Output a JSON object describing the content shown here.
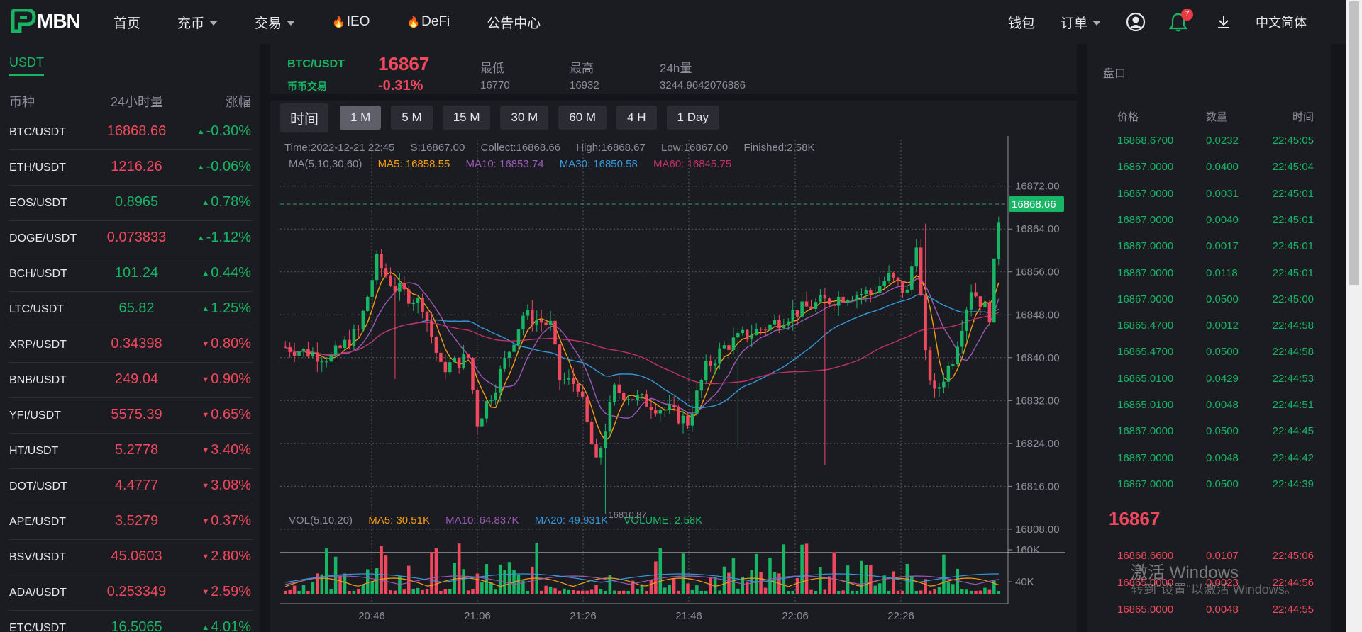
{
  "header": {
    "logo_text": "MBN",
    "nav": [
      {
        "label": "首页",
        "caret": false,
        "fire": false
      },
      {
        "label": "充币",
        "caret": true,
        "fire": false
      },
      {
        "label": "交易",
        "caret": true,
        "fire": false
      },
      {
        "label": "IEO",
        "caret": false,
        "fire": true
      },
      {
        "label": "DeFi",
        "caret": false,
        "fire": true
      },
      {
        "label": "公告中心",
        "caret": false,
        "fire": false
      }
    ],
    "wallet": "钱包",
    "orders": "订单",
    "notification_count": "7",
    "language": "中文简体"
  },
  "market": {
    "tab": "USDT",
    "col_coin": "币种",
    "col_volume": "24小时量",
    "col_change": "涨幅",
    "rows": [
      {
        "symbol": "BTC/USDT",
        "price": "16868.66",
        "change": "-0.30%",
        "price_dir": "down",
        "change_dir": "up"
      },
      {
        "symbol": "ETH/USDT",
        "price": "1216.26",
        "change": "-0.06%",
        "price_dir": "down",
        "change_dir": "up"
      },
      {
        "symbol": "EOS/USDT",
        "price": "0.8965",
        "change": "0.78%",
        "price_dir": "up",
        "change_dir": "up"
      },
      {
        "symbol": "DOGE/USDT",
        "price": "0.073833",
        "change": "-1.12%",
        "price_dir": "down",
        "change_dir": "up"
      },
      {
        "symbol": "BCH/USDT",
        "price": "101.24",
        "change": "0.44%",
        "price_dir": "up",
        "change_dir": "up"
      },
      {
        "symbol": "LTC/USDT",
        "price": "65.82",
        "change": "1.25%",
        "price_dir": "up",
        "change_dir": "up"
      },
      {
        "symbol": "XRP/USDT",
        "price": "0.34398",
        "change": "0.80%",
        "price_dir": "down",
        "change_dir": "down"
      },
      {
        "symbol": "BNB/USDT",
        "price": "249.04",
        "change": "0.90%",
        "price_dir": "down",
        "change_dir": "down"
      },
      {
        "symbol": "YFI/USDT",
        "price": "5575.39",
        "change": "0.65%",
        "price_dir": "down",
        "change_dir": "down"
      },
      {
        "symbol": "HT/USDT",
        "price": "5.2778",
        "change": "3.40%",
        "price_dir": "down",
        "change_dir": "down"
      },
      {
        "symbol": "DOT/USDT",
        "price": "4.4777",
        "change": "3.08%",
        "price_dir": "down",
        "change_dir": "down"
      },
      {
        "symbol": "APE/USDT",
        "price": "3.5279",
        "change": "0.37%",
        "price_dir": "down",
        "change_dir": "down"
      },
      {
        "symbol": "BSV/USDT",
        "price": "45.0603",
        "change": "2.80%",
        "price_dir": "down",
        "change_dir": "down"
      },
      {
        "symbol": "ADA/USDT",
        "price": "0.253349",
        "change": "2.59%",
        "price_dir": "down",
        "change_dir": "down"
      },
      {
        "symbol": "ETC/USDT",
        "price": "16.5065",
        "change": "4.01%",
        "price_dir": "up",
        "change_dir": "up"
      }
    ]
  },
  "ticker": {
    "pair": "BTC/USDT",
    "sub": "币币交易",
    "price": "16867",
    "change": "-0.31%",
    "low_label": "最低",
    "low": "16770",
    "high_label": "最高",
    "high": "16932",
    "vol_label": "24h量",
    "vol": "3244.9642076886"
  },
  "intervals": {
    "label": "时间",
    "buttons": [
      "1 M",
      "5 M",
      "15 M",
      "30 M",
      "60 M",
      "4 H",
      "1 Day"
    ],
    "active": "1 M"
  },
  "chart_info": {
    "time": "Time:2022-12-21 22:45",
    "s": "S:16867.00",
    "collect": "Collect:16868.66",
    "high": "High:16868.67",
    "low": "Low:16867.00",
    "finished": "Finished:2.58K",
    "ma_label": "MA(5,10,30,60)",
    "ma5": "MA5: 16858.55",
    "ma10": "MA10: 16853.74",
    "ma30": "MA30: 16850.58",
    "ma60": "MA60: 16845.75",
    "vol_label": "VOL(5,10,20)",
    "vol_ma5": "MA5: 30.51K",
    "vol_ma10": "MA10: 64.837K",
    "vol_ma20": "MA20: 49.931K",
    "vol_volume": "VOLUME: 2.58K",
    "current_price": "16868.66",
    "low_marker": "16810.87"
  },
  "colors": {
    "up": "#18b565",
    "down": "#f0485c",
    "ma5": "#f39c12",
    "ma10": "#9b59b6",
    "ma30": "#3498db",
    "ma60": "#c0306a"
  },
  "chart_data": {
    "type": "candlestick",
    "title": "",
    "price_ticks": [
      "16872.00",
      "16864.00",
      "16856.00",
      "16848.00",
      "16840.00",
      "16832.00",
      "16824.00",
      "16816.00",
      "16808.00"
    ],
    "volume_ticks": [
      "160K",
      "40K"
    ],
    "x_ticks": [
      "20:46",
      "21:06",
      "21:26",
      "21:46",
      "22:06",
      "22:26"
    ],
    "ylim": [
      16806,
      16875
    ]
  },
  "orderbook": {
    "title": "盘口",
    "col_price": "价格",
    "col_amount": "数量",
    "col_time": "时间",
    "trades": [
      {
        "price": "16868.6700",
        "amount": "0.0232",
        "time": "22:45:05",
        "side": "up"
      },
      {
        "price": "16867.0000",
        "amount": "0.0400",
        "time": "22:45:04",
        "side": "up"
      },
      {
        "price": "16867.0000",
        "amount": "0.0031",
        "time": "22:45:01",
        "side": "up"
      },
      {
        "price": "16867.0000",
        "amount": "0.0040",
        "time": "22:45:01",
        "side": "up"
      },
      {
        "price": "16867.0000",
        "amount": "0.0017",
        "time": "22:45:01",
        "side": "up"
      },
      {
        "price": "16867.0000",
        "amount": "0.0118",
        "time": "22:45:01",
        "side": "up"
      },
      {
        "price": "16867.0000",
        "amount": "0.0500",
        "time": "22:45:00",
        "side": "up"
      },
      {
        "price": "16865.4700",
        "amount": "0.0012",
        "time": "22:44:58",
        "side": "up"
      },
      {
        "price": "16865.4700",
        "amount": "0.0500",
        "time": "22:44:58",
        "side": "up"
      },
      {
        "price": "16865.0100",
        "amount": "0.0429",
        "time": "22:44:53",
        "side": "up"
      },
      {
        "price": "16865.0100",
        "amount": "0.0048",
        "time": "22:44:51",
        "side": "up"
      },
      {
        "price": "16867.0000",
        "amount": "0.0500",
        "time": "22:44:45",
        "side": "up"
      },
      {
        "price": "16867.0000",
        "amount": "0.0048",
        "time": "22:44:42",
        "side": "up"
      },
      {
        "price": "16867.0000",
        "amount": "0.0500",
        "time": "22:44:39",
        "side": "up"
      }
    ],
    "last_price": "16867",
    "asks": [
      {
        "price": "16868.6600",
        "amount": "0.0107",
        "time": "22:45:06",
        "side": "down"
      },
      {
        "price": "16865.0000",
        "amount": "0.0023",
        "time": "22:44:56",
        "side": "down"
      },
      {
        "price": "16865.0000",
        "amount": "0.0048",
        "time": "22:44:55",
        "side": "down"
      }
    ]
  },
  "watermark": {
    "line1": "激活 Windows",
    "line2": "转到\"设置\"以激活 Windows。"
  }
}
